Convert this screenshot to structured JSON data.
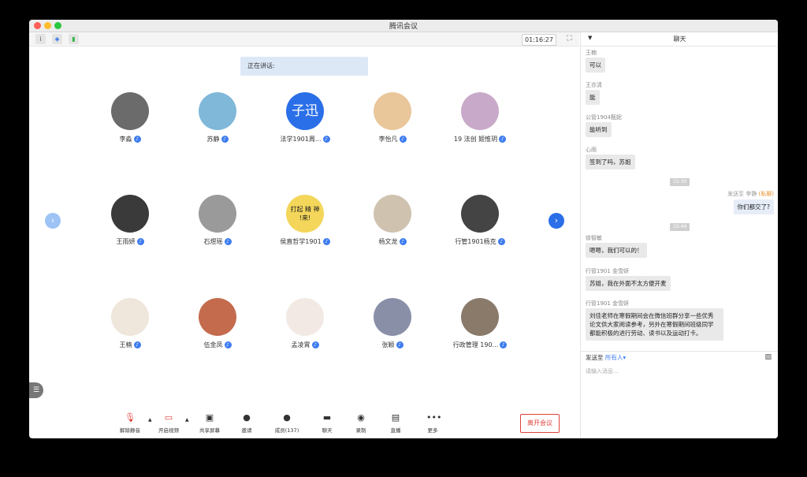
{
  "window": {
    "title": "腾讯会议"
  },
  "toolbar": {
    "timer": "01:16:27",
    "info_icon": "info-icon",
    "shield_icon": "shield-icon",
    "signal_icon": "signal-icon"
  },
  "speaking": {
    "label": "正在讲话:"
  },
  "participants": [
    {
      "name": "李淼",
      "avatar_color": "#6b6b6b",
      "mic": "on"
    },
    {
      "name": "苏静",
      "avatar_color": "#7fb8d8",
      "mic": "on"
    },
    {
      "name": "法学1901周...",
      "avatar_text": "子迅",
      "avatar_color": "#2a6fe8",
      "mic": "on"
    },
    {
      "name": "李怡凡",
      "avatar_color": "#e9c79a",
      "mic": "on"
    },
    {
      "name": "19 法创 姬惟玥",
      "avatar_color": "#c9a9c9",
      "mic": "on"
    },
    {
      "name": "王雨妍",
      "avatar_color": "#3a3a3a",
      "mic": "on"
    },
    {
      "name": "石煜瑶",
      "avatar_color": "#9a9a9a",
      "mic": "on"
    },
    {
      "name": "侯直哲学1901",
      "avatar_text": "打起 精 神 !来!",
      "avatar_color": "#f3d65a",
      "mic": "on"
    },
    {
      "name": "杨文龙",
      "avatar_color": "#cfc3b0",
      "mic": "on"
    },
    {
      "name": "行管1901杨克",
      "avatar_color": "#444444",
      "mic": "on"
    },
    {
      "name": "王楠",
      "avatar_color": "#efe6dc",
      "mic": "on"
    },
    {
      "name": "伍金凤",
      "avatar_color": "#c46b4e",
      "mic": "on"
    },
    {
      "name": "孟凌霄",
      "avatar_color": "#f2e9e4",
      "mic": "on"
    },
    {
      "name": "张颖",
      "avatar_color": "#8a8fa8",
      "mic": "on"
    },
    {
      "name": "行政管理 190...",
      "avatar_color": "#8a7a6a",
      "mic": "on"
    }
  ],
  "bottombar": {
    "buttons": [
      {
        "label": "解除静音",
        "icon": "mic-muted-icon"
      },
      {
        "label": "开启视频",
        "icon": "video-off-icon"
      },
      {
        "label": "共享屏幕",
        "icon": "share-screen-icon"
      },
      {
        "label": "邀请",
        "icon": "invite-icon"
      },
      {
        "label": "成员(137)",
        "icon": "members-icon"
      },
      {
        "label": "聊天",
        "icon": "chat-icon"
      },
      {
        "label": "录制",
        "icon": "record-icon"
      },
      {
        "label": "直播",
        "icon": "live-icon"
      },
      {
        "label": "更多",
        "icon": "more-icon"
      }
    ],
    "leave": "离开会议"
  },
  "chat": {
    "title": "聊天",
    "messages": [
      {
        "sender": "王楠",
        "text": "可以"
      },
      {
        "sender": "王亦清",
        "text": "能"
      },
      {
        "sender": "公管1904甄妮",
        "text": "能听到"
      },
      {
        "sender": "心雨",
        "text": "签到了吗，苏姐"
      }
    ],
    "time1": "15:30",
    "private": {
      "prefix": "发送至 李静",
      "tag": "(私聊)",
      "text": "你们都交了?"
    },
    "time2": "15:44",
    "messages2": [
      {
        "sender": "徐智敏",
        "text": "嗯嗯，我们可以的！"
      },
      {
        "sender": "行管1901 金雪妍",
        "text": "苏姐，我在外面不太方便开麦"
      },
      {
        "sender": "行管1901 金雪妍",
        "lines": [
          "刘佳老师在寒假期间会在微信班群分享一些优秀",
          "论文供大家阅读参考，另外在寒假期间班级同学",
          "都能积极的进行劳动、读书以及运动打卡。"
        ]
      }
    ],
    "send_to": "发送至",
    "send_to_all": "所有人",
    "input_placeholder": "请输入消息..."
  }
}
